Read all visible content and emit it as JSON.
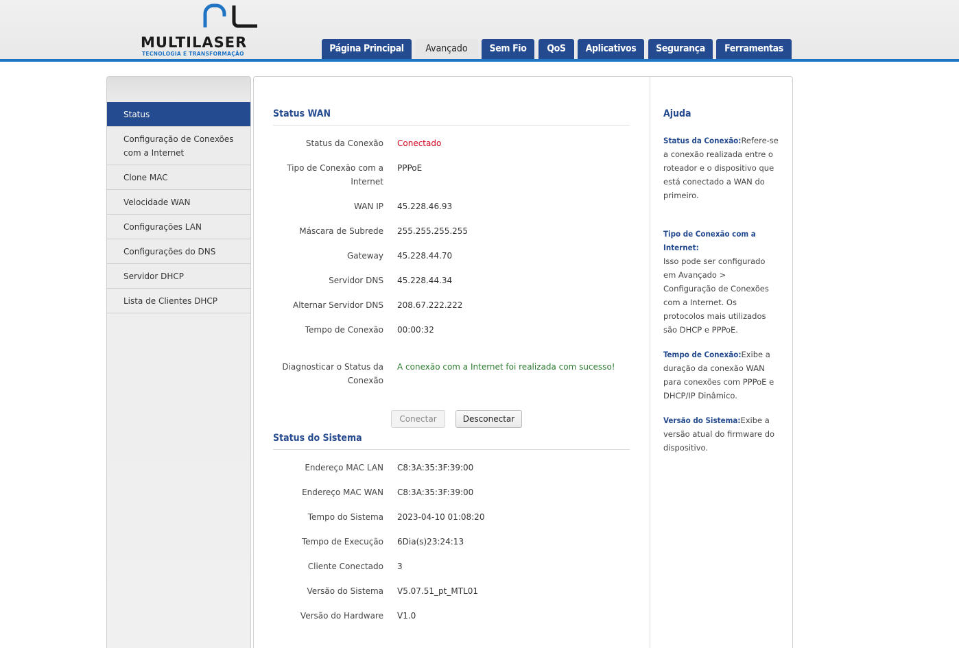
{
  "brand": {
    "name": "MULTILASER",
    "tagline": "TECNOLOGIA E TRANSFORMAÇÃO",
    "accent": "#1f74c4",
    "nav_color": "#244a8f"
  },
  "tabs": [
    {
      "label": "Página Principal"
    },
    {
      "label": "Avançado",
      "active": true
    },
    {
      "label": "Sem Fio"
    },
    {
      "label": "QoS"
    },
    {
      "label": "Aplicativos"
    },
    {
      "label": "Segurança"
    },
    {
      "label": "Ferramentas"
    }
  ],
  "sidebar": {
    "items": [
      {
        "label": "Status",
        "active": true
      },
      {
        "label": "Configuração de Conexões com a Internet"
      },
      {
        "label": "Clone MAC"
      },
      {
        "label": "Velocidade WAN"
      },
      {
        "label": "Configurações LAN"
      },
      {
        "label": "Configurações do DNS"
      },
      {
        "label": "Servidor DHCP"
      },
      {
        "label": "Lista de Clientes DHCP"
      }
    ]
  },
  "wan": {
    "title": "Status WAN",
    "rows": [
      {
        "label": "Status da Conexão",
        "value": "Conectado"
      },
      {
        "label": "Tipo de Conexão com a Internet",
        "value": "PPPoE"
      },
      {
        "label": "WAN IP",
        "value": "45.228.46.93"
      },
      {
        "label": "Máscara de Subrede",
        "value": "255.255.255.255"
      },
      {
        "label": "Gateway",
        "value": "45.228.44.70"
      },
      {
        "label": "Servidor DNS",
        "value": "45.228.44.34"
      },
      {
        "label": "Alternar Servidor DNS",
        "value": "208.67.222.222"
      },
      {
        "label": "Tempo de Conexão",
        "value": "00:00:32"
      },
      {
        "label": "Diagnosticar o Status da Conexão",
        "value": "A conexão com a Internet foi realizada com sucesso!"
      }
    ],
    "connect_label": "Conectar",
    "disconnect_label": "Desconectar"
  },
  "system": {
    "title": "Status do Sistema",
    "rows": [
      {
        "label": "Endereço MAC LAN",
        "value": "C8:3A:35:3F:39:00"
      },
      {
        "label": "Endereço MAC WAN",
        "value": "C8:3A:35:3F:39:00"
      },
      {
        "label": "Tempo do Sistema",
        "value": "2023-04-10 01:08:20"
      },
      {
        "label": "Tempo de Execução",
        "value": "6Dia(s)23:24:13"
      },
      {
        "label": "Cliente Conectado",
        "value": "3"
      },
      {
        "label": "Versão do Sistema",
        "value": "V5.07.51_pt_MTL01"
      },
      {
        "label": "Versão do Hardware",
        "value": "V1.0"
      }
    ]
  },
  "help": {
    "title": "Ajuda",
    "items": [
      {
        "heading": "Status da Conexão:",
        "text": "Refere-se a conexão realizada entre o roteador e o dispositivo que está conectado a WAN do primeiro."
      },
      {
        "heading": "Tipo de Conexão com a Internet:",
        "text": "Isso pode ser configurado em Avançado > Configuração de Conexões com a Internet. Os protocolos mais utilizados são DHCP e PPPoE."
      },
      {
        "heading": "Tempo de Conexão:",
        "text": "Exibe a duração da conexão WAN para conexões com PPPoE e DHCP/IP Dinâmico."
      },
      {
        "heading": "Versão do Sistema:",
        "text": "Exibe a versão atual do firmware do dispositivo."
      }
    ]
  }
}
